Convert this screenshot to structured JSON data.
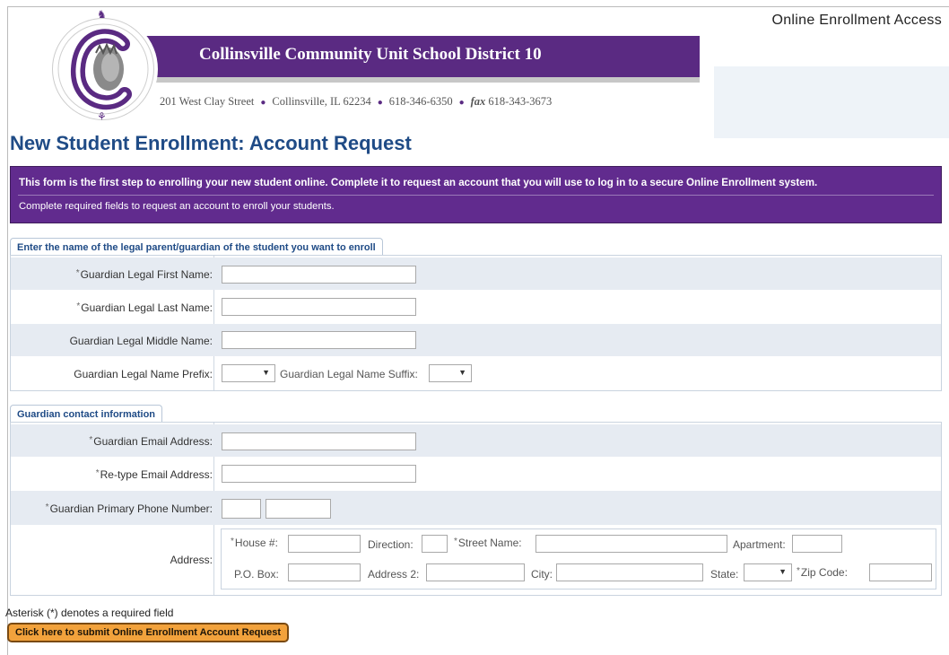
{
  "header": {
    "portal_title": "Online Enrollment Access",
    "district_name": "Collinsville Community Unit School District 10",
    "street": "201 West Clay Street",
    "city": "Collinsville, IL 62234",
    "phone": "618-346-6350",
    "fax_label": "fax",
    "fax": "618-343-3673"
  },
  "page_title": "New Student Enrollment: Account Request",
  "notice": {
    "line1": "This form is the first step to enrolling your new student online. Complete it to request an account that you will use to log in to a secure Online Enrollment system.",
    "line2": "Complete required fields to request an account to enroll your students."
  },
  "guardian_name_section": {
    "tab": "Enter the name of the legal parent/guardian of the student you want to enroll",
    "first_name_label": "Guardian Legal First Name:",
    "last_name_label": "Guardian Legal Last Name:",
    "middle_name_label": "Guardian Legal Middle Name:",
    "prefix_label": "Guardian Legal Name Prefix:",
    "suffix_label": "Guardian Legal Name Suffix:",
    "first_name_value": "",
    "last_name_value": "",
    "middle_name_value": "",
    "prefix_value": "",
    "suffix_value": ""
  },
  "contact_section": {
    "tab": "Guardian contact information",
    "email_label": "Guardian Email Address:",
    "retype_email_label": "Re-type Email Address:",
    "phone_label": "Guardian Primary Phone Number:",
    "address_label": "Address:",
    "email_value": "",
    "retype_email_value": "",
    "phone_area_value": "",
    "phone_number_value": "",
    "address": {
      "house_label": "House #:",
      "direction_label": "Direction:",
      "street_label": "Street Name:",
      "apartment_label": "Apartment:",
      "po_box_label": "P.O. Box:",
      "address2_label": "Address 2:",
      "city_label": "City:",
      "state_label": "State:",
      "zip_label": "Zip Code:",
      "state_value": ""
    }
  },
  "required_star": "*",
  "required_note": "Asterisk (*) denotes a required field",
  "submit_label": "Click here to submit Online Enrollment Account Request",
  "colors": {
    "brand_purple": "#5a2a82",
    "notice_purple": "#612b8e",
    "title_blue": "#1f4b86",
    "row_alt": "#e6ebf2",
    "submit_orange": "#f2a23c"
  },
  "icons": {
    "dropdown": "chevron-down-icon",
    "logo": "district-seal-logo"
  }
}
